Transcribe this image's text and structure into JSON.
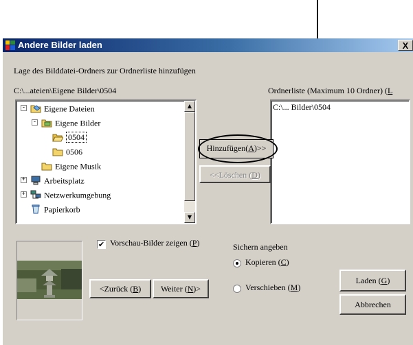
{
  "window": {
    "title": "Andere Bilder laden",
    "close_label": "X"
  },
  "instruction": "Lage des Bilddatei-Ordners zur Ordnerliste hinzufügen",
  "current_path": "C:\\...ateien\\Eigene Bilder\\0504",
  "folder_list_label": {
    "text": "Ordnerliste (Maximum 10 Ordner) (",
    "hotkey": "L"
  },
  "tree": [
    {
      "label": "Eigene Dateien",
      "icon": "folder-documents-icon",
      "expander": "-"
    },
    {
      "label": "Eigene Bilder",
      "icon": "folder-pictures-icon",
      "expander": "-"
    },
    {
      "label": "0504",
      "icon": "open-folder-icon",
      "selected": true
    },
    {
      "label": "0506",
      "icon": "folder-icon"
    },
    {
      "label": "Eigene Musik",
      "icon": "folder-icon"
    },
    {
      "label": "Arbeitsplatz",
      "icon": "computer-icon",
      "expander": "+"
    },
    {
      "label": "Netzwerkumgebung",
      "icon": "network-icon",
      "expander": "+"
    },
    {
      "label": "Papierkorb",
      "icon": "recycle-bin-icon"
    }
  ],
  "folder_list": {
    "items": [
      "C:\\... Bilder\\0504"
    ]
  },
  "buttons": {
    "add": {
      "before": "Hinzufügen(",
      "hotkey": "A",
      "after": ")>>"
    },
    "delete": {
      "before": "<<Löschen (",
      "hotkey": "D",
      "after": ")"
    },
    "back": {
      "before": "<Zurück (",
      "hotkey": "B",
      "after": ")"
    },
    "next": {
      "before": "Weiter (",
      "hotkey": "N",
      "after": ")>"
    },
    "load": {
      "before": "Laden (",
      "hotkey": "G",
      "after": ")"
    },
    "cancel": "Abbrechen"
  },
  "preview_checkbox": {
    "before": "Vorschau-Bilder zeigen (",
    "hotkey": "P",
    "after": ")",
    "checked": true
  },
  "save_group": {
    "label": "Sichern angeben",
    "copy": {
      "before": "Kopieren (",
      "hotkey": "C",
      "after": ")",
      "selected": true
    },
    "move": {
      "before": "Verschieben (",
      "hotkey": "M",
      "after": ")",
      "selected": false
    }
  }
}
